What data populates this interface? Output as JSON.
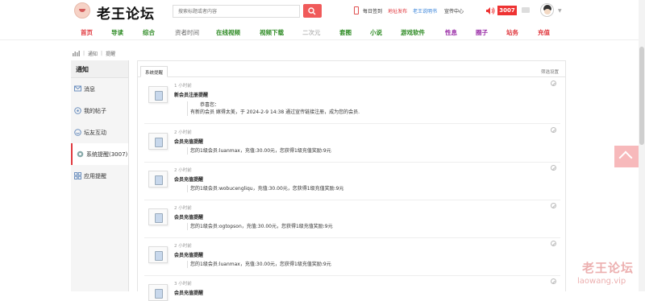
{
  "site": {
    "logo_text": "老王论坛"
  },
  "search": {
    "placeholder": "搜索标题或者内容"
  },
  "top_links": {
    "checkin": "每日签到",
    "publish": "地址发布",
    "backup": "老王说明书",
    "homepage": "宣传中心"
  },
  "notify_count": "3007",
  "nav": [
    {
      "label": "首页",
      "color": "#e0393f"
    },
    {
      "label": "导读",
      "color": "#2e8b24"
    },
    {
      "label": "综合",
      "color": "#2e8b24"
    },
    {
      "label": "资者时间",
      "color": "#666666"
    },
    {
      "label": "在线视频",
      "color": "#2e8b24"
    },
    {
      "label": "视频下载",
      "color": "#2e8b24"
    },
    {
      "label": "二次元",
      "color": "#999999"
    },
    {
      "label": "套图",
      "color": "#2e8b24"
    },
    {
      "label": "小说",
      "color": "#2e8b24"
    },
    {
      "label": "游戏软件",
      "color": "#2e8b24"
    },
    {
      "label": "性息",
      "color": "#9b2fa8"
    },
    {
      "label": "圈子",
      "color": "#9b2fa8"
    },
    {
      "label": "站务",
      "color": "#e0393f"
    },
    {
      "label": "充值",
      "color": "#e0393f"
    }
  ],
  "breadcrumb": {
    "item1": "通知",
    "item2": "提醒"
  },
  "sidebar": {
    "title": "通知",
    "items": [
      {
        "label": "消息",
        "icon": "message-icon"
      },
      {
        "label": "我的帖子",
        "icon": "post-icon"
      },
      {
        "label": "坛友互动",
        "icon": "interaction-icon"
      },
      {
        "label": "系统提醒(3007)",
        "icon": "system-icon"
      },
      {
        "label": "应用提醒",
        "icon": "app-icon"
      }
    ]
  },
  "main": {
    "tab_label": "系统提醒",
    "filter_label": "筛选设置"
  },
  "notices": [
    {
      "time": "1 小时前",
      "title": "新会员注册提醒",
      "greeting": "恭喜您：",
      "body": "有新的会员 嫁得太美，于 2024-2-9 14:38 通过宣传链接注册，成为您的会员."
    },
    {
      "time": "2 小时前",
      "title": "会员充值提醒",
      "greeting": "",
      "body": "您的1级会员:luanmax，充值:30.00元，您获得1级充值奖励:9元"
    },
    {
      "time": "2 小时前",
      "title": "会员充值提醒",
      "greeting": "",
      "body": "您的1级会员:wobucengliqu，充值:30.00元，您获得1级充值奖励:9元"
    },
    {
      "time": "2 小时前",
      "title": "会员充值提醒",
      "greeting": "",
      "body": "您的1级会员:ogtopson，充值:30.00元，您获得1级充值奖励:9元"
    },
    {
      "time": "2 小时前",
      "title": "会员充值提醒",
      "greeting": "",
      "body": "您的1级会员:luanmax，充值:30.00元，您获得1级充值奖励:9元"
    },
    {
      "time": "3 小时前",
      "title": "会员充值提醒",
      "greeting": "",
      "body": ""
    }
  ],
  "watermark": {
    "cn": "老王论坛",
    "en": "laowang.vip"
  }
}
